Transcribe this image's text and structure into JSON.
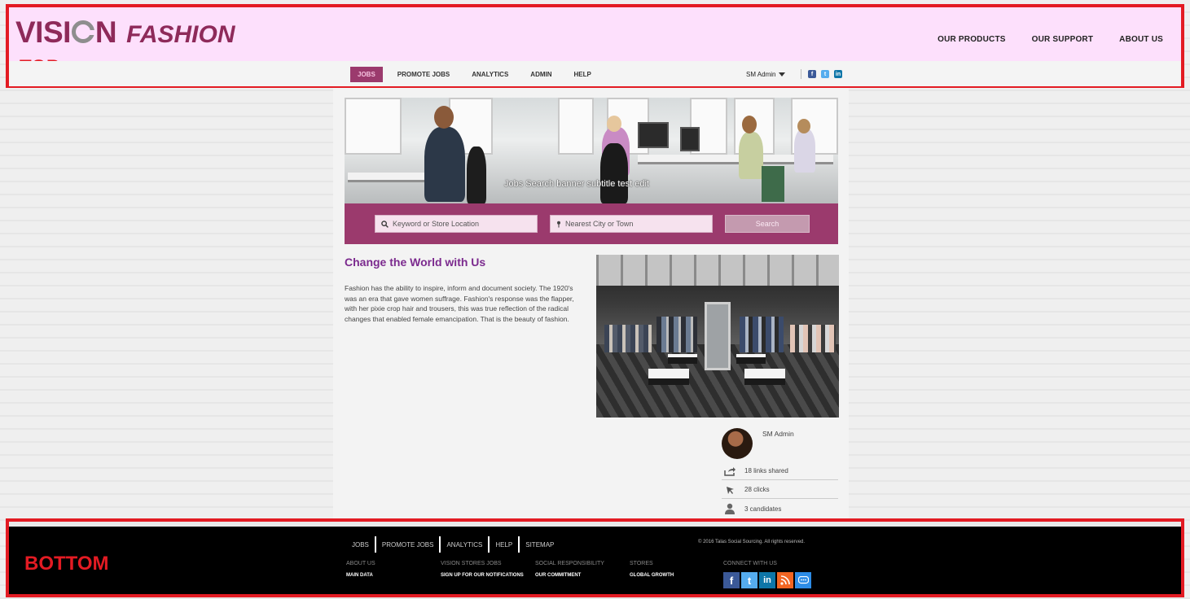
{
  "header": {
    "logo_part1": "VISI",
    "logo_part2": "N",
    "logo_fashion": "FASHION",
    "region_label": "TOP",
    "top_nav": [
      "OUR PRODUCTS",
      "OUR SUPPORT",
      "ABOUT US"
    ],
    "sub_nav": [
      {
        "label": "JOBS",
        "active": true
      },
      {
        "label": "PROMOTE JOBS",
        "active": false
      },
      {
        "label": "ANALYTICS",
        "active": false
      },
      {
        "label": "ADMIN",
        "active": false
      },
      {
        "label": "HELP",
        "active": false
      }
    ],
    "admin_label": "SM Admin"
  },
  "hero": {
    "caption": "Jobs Search banner subtitle test edit"
  },
  "search": {
    "keyword_placeholder": "Keyword or Store Location",
    "city_placeholder": "Nearest City or Town",
    "button_label": "Search"
  },
  "article": {
    "title": "Change the World with Us",
    "body": "Fashion has the ability to inspire, inform and document society. The 1920's was an era that gave women suffrage. Fashion's response was the flapper, with her pixie crop hair and trousers, this was true reflection of the radical changes that enabled female emancipation. That is the beauty of fashion."
  },
  "profile": {
    "name": "SM Admin",
    "stats": {
      "links": "18 links shared",
      "clicks": "28 clicks",
      "candidates": "3 candidates"
    }
  },
  "footer": {
    "region_label": "BOTTOM",
    "links": [
      "JOBS",
      "PROMOTE JOBS",
      "ANALYTICS",
      "HELP",
      "SITEMAP"
    ],
    "copyright": "© 2016 Talas Social Sourcing. All rights reserved.",
    "columns": [
      {
        "head": "ABOUT US",
        "link": "MAIN DATA"
      },
      {
        "head": "VISION STORES JOBS",
        "link": "SIGN UP FOR OUR NOTIFICATIONS"
      },
      {
        "head": "SOCIAL RESPONSIBILITY",
        "link": "OUR COMMITMENT"
      },
      {
        "head": "STORES",
        "link": "GLOBAL GROWTH"
      }
    ],
    "connect_label": "CONNECT WITH US"
  },
  "colors": {
    "brand": "#9b3a6d",
    "highlight_frame": "#e31b23",
    "header_bg": "#fde0fc",
    "title": "#7b2a8e"
  }
}
